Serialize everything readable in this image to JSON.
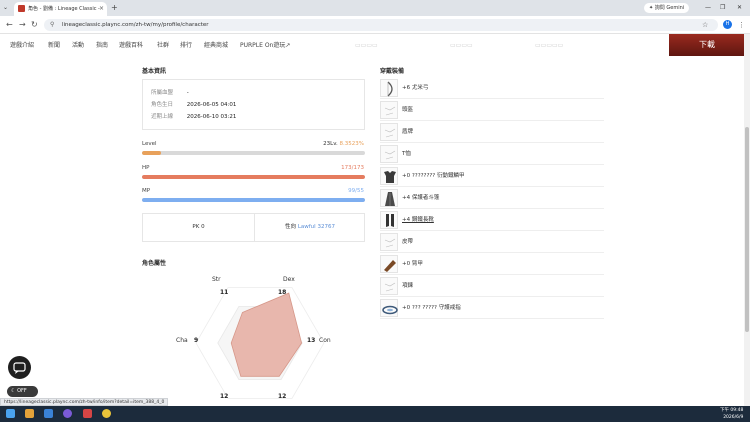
{
  "browser": {
    "tab_title": "角色 - 劉備 : Lineage Classic -",
    "tab_close": "×",
    "new_tab": "+",
    "url": "lineageclassic.plaync.com/zh-tw/my/profile/character",
    "gemini_label": "詢問 Gemini",
    "avatar_letter": "H"
  },
  "site_nav": {
    "items": [
      "遊戲介紹",
      "新聞",
      "活動",
      "指南",
      "遊戲百科",
      "社群",
      "排行",
      "經典商城",
      "PURPLE On遊玩↗"
    ],
    "download_label": "下載"
  },
  "basic_info": {
    "title": "基本資訊",
    "rows": [
      {
        "label": "所屬血盟",
        "value": "-"
      },
      {
        "label": "角色生日",
        "value": "2026-06-05 04:01"
      },
      {
        "label": "近期上線",
        "value": "2026-06-10 03:21"
      }
    ]
  },
  "stats": {
    "level": {
      "label": "Level",
      "value_text": "23Lv.",
      "percent_text": "8.3523%",
      "fill_fraction": 0.083,
      "color": "#e8a15b"
    },
    "hp": {
      "label": "HP",
      "value_text": "173/173",
      "fill_fraction": 1.0,
      "color": "#e57c5f"
    },
    "mp": {
      "label": "MP",
      "value_text": "99/55",
      "fill_fraction": 1.0,
      "color": "#7eaef0"
    }
  },
  "pk": {
    "text": "PK 0",
    "alignment_label": "性向",
    "alignment_value": "Lawful 32767"
  },
  "attributes": {
    "title": "角色屬性",
    "labels": {
      "str": "Str",
      "dex": "Dex",
      "con": "Con",
      "cha": "Cha"
    },
    "values": {
      "str": 11,
      "dex": 18,
      "con": 13,
      "int": 12,
      "wis": 12,
      "cha": 9
    },
    "fill_color": "#e8b7ad",
    "stroke_color": "#d69789"
  },
  "equipment": {
    "title": "穿戴裝備",
    "items": [
      {
        "name": "+6 尤米弓",
        "icon": "bow-icon",
        "underline": false
      },
      {
        "name": "頭盔",
        "icon": "empty-slot-icon",
        "underline": false
      },
      {
        "name": "盾牌",
        "icon": "empty-slot-icon",
        "underline": false
      },
      {
        "name": "T恤",
        "icon": "empty-slot-icon",
        "underline": false
      },
      {
        "name": "+0 ???????? 衍動鐵鱗甲",
        "icon": "armor-icon",
        "underline": false
      },
      {
        "name": "+4 保護者斗篷",
        "icon": "cloak-icon",
        "underline": false
      },
      {
        "name": "+4 鋼鐵長靴",
        "icon": "boots-icon",
        "underline": true
      },
      {
        "name": "皮帶",
        "icon": "empty-slot-icon",
        "underline": false
      },
      {
        "name": "+0 臂甲",
        "icon": "gauntlet-icon",
        "underline": false
      },
      {
        "name": "項鍊",
        "icon": "empty-slot-icon",
        "underline": false
      },
      {
        "name": "+0 ??? ????? 守護戒指",
        "icon": "ring-icon",
        "underline": false
      }
    ]
  },
  "widgets": {
    "toggle_label": "OFF"
  },
  "statusbar": {
    "text": "https://lineageclassic.plaync.com/zh-tw/info/item?detail=item_388_4_0"
  },
  "taskbar": {
    "time": "下午 09:48",
    "date": "2026/6/9"
  }
}
